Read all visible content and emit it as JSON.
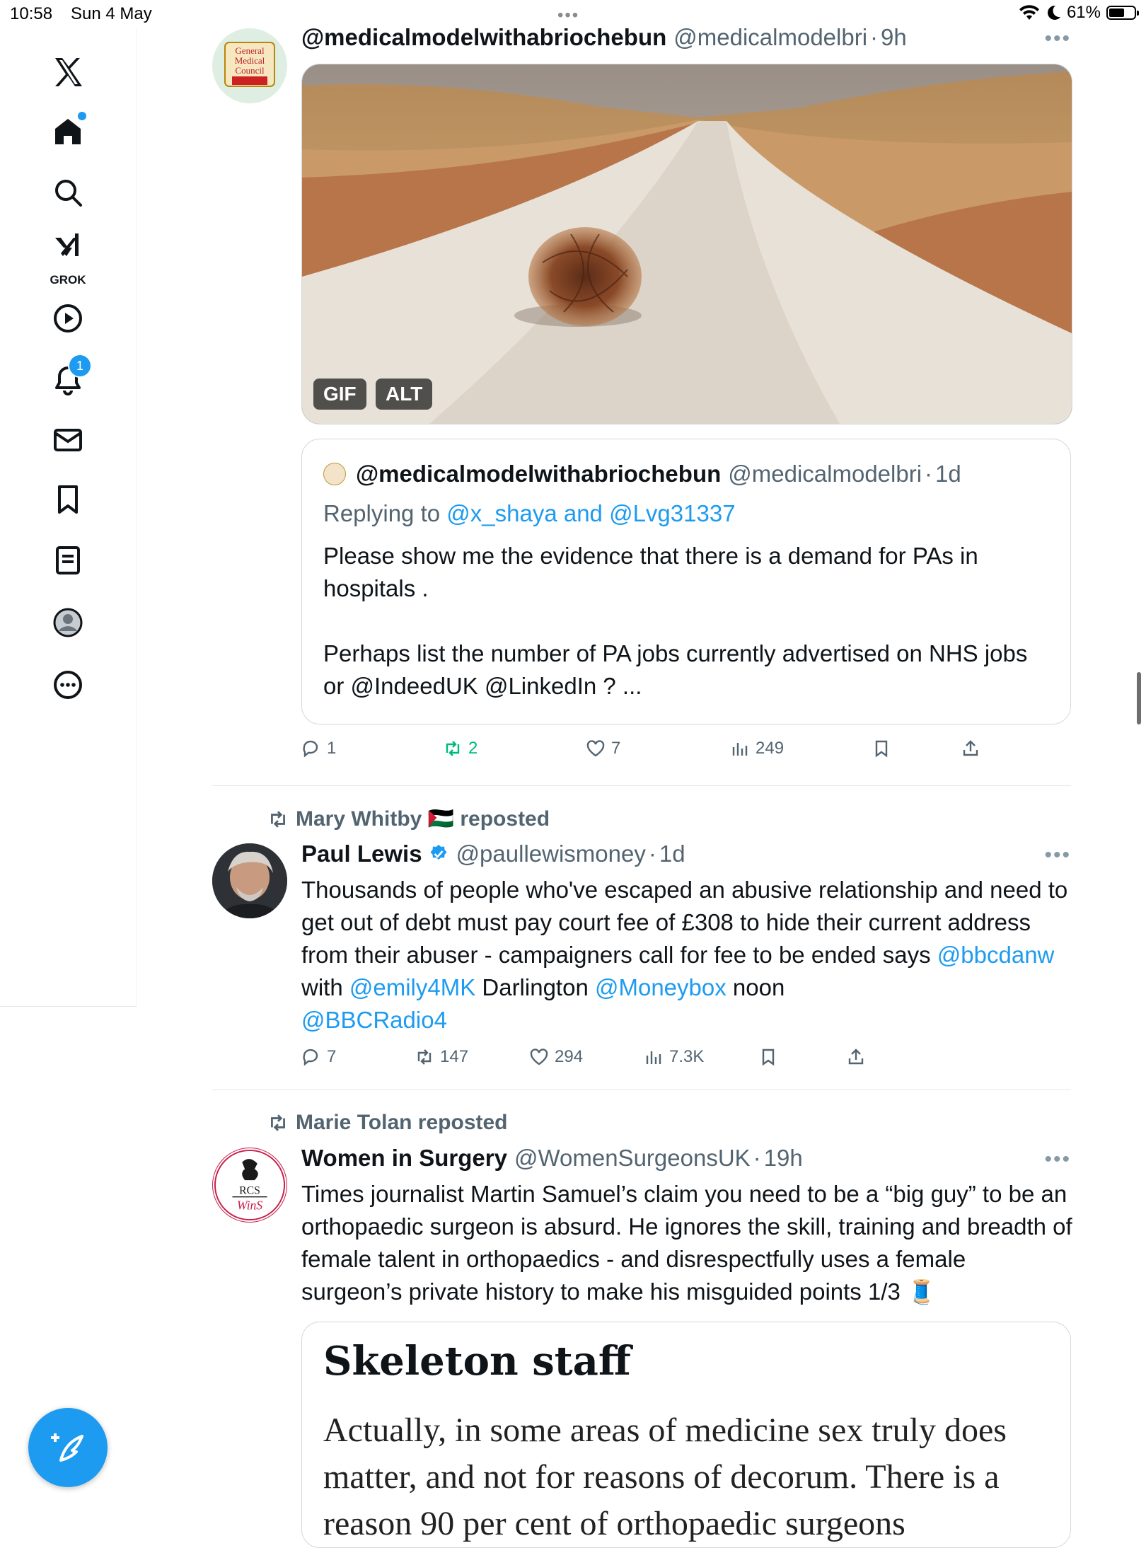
{
  "status_bar": {
    "time": "10:58",
    "date": "Sun 4 May",
    "battery": "61%",
    "battery_level": 0.61
  },
  "sidebar": {
    "items": [
      {
        "name": "x-logo"
      },
      {
        "name": "home",
        "has_dot": true
      },
      {
        "name": "search"
      },
      {
        "name": "grok",
        "label": "GROK"
      },
      {
        "name": "video"
      },
      {
        "name": "notifications",
        "badge": "1"
      },
      {
        "name": "messages"
      },
      {
        "name": "bookmarks"
      },
      {
        "name": "lists"
      },
      {
        "name": "profile"
      },
      {
        "name": "more"
      }
    ]
  },
  "tweets": [
    {
      "name": "@medicalmodelwithabriochebun",
      "handle": "@medicalmodelbri",
      "time": "9h",
      "media": {
        "badges": [
          "GIF",
          "ALT"
        ]
      },
      "quote": {
        "name": "@medicalmodelwithabriochebun",
        "handle": "@medicalmodelbri",
        "time": "1d",
        "replying_prefix": "Replying to ",
        "replying_to": "@x_shaya and @Lvg31337",
        "text_1": "Please show me the evidence that there is a demand for PAs in hospitals .",
        "text_2": "Perhaps list the number of  PA jobs currently advertised on NHS jobs or @IndeedUK  @LinkedIn  ? ..."
      },
      "stats": {
        "replies": "1",
        "reposts": "2",
        "likes": "7",
        "views": "249"
      }
    },
    {
      "reposted_by": "Mary Whitby 🇵🇸 reposted",
      "name": "Paul Lewis",
      "handle": "@paullewismoney",
      "time": "1d",
      "text_1": "Thousands of people who've escaped an abusive relationship and need to get out of debt must pay court fee of £308 to hide their current address from their abuser - campaigners call for fee to be ended says ",
      "mention_1": "@bbcdanw",
      "text_2": " with ",
      "mention_2": "@emily4MK",
      "text_3": " Darlington ",
      "mention_3": "@Moneybox",
      "text_4": " noon ",
      "mention_4": "@BBCRadio4",
      "stats": {
        "replies": "7",
        "reposts": "147",
        "likes": "294",
        "views": "7.3K"
      }
    },
    {
      "reposted_by": "Marie Tolan reposted",
      "name": "Women in Surgery",
      "handle": "@WomenSurgeonsUK",
      "time": "19h",
      "text": "Times journalist Martin Samuel’s claim you need to be a “big guy” to be an orthopaedic surgeon is absurd. He ignores the skill, training and breadth of female talent in orthopaedics - and disrespectfully uses a female surgeon’s private history to make his misguided points 1/3 🧵",
      "article": {
        "title": "Skeleton staff",
        "text": "Actually, in some areas of medicine sex truly does matter, and not for reasons of decorum. There is a reason 90 per cent of orthopaedic surgeons"
      }
    }
  ],
  "avatars": {
    "gmc_text": "General Medical Council",
    "rcs_text": "RCS",
    "wins_text": "WinS"
  },
  "colors": {
    "accent": "#1d9bf0",
    "repost_active": "#00ba7c",
    "muted": "#536471"
  }
}
